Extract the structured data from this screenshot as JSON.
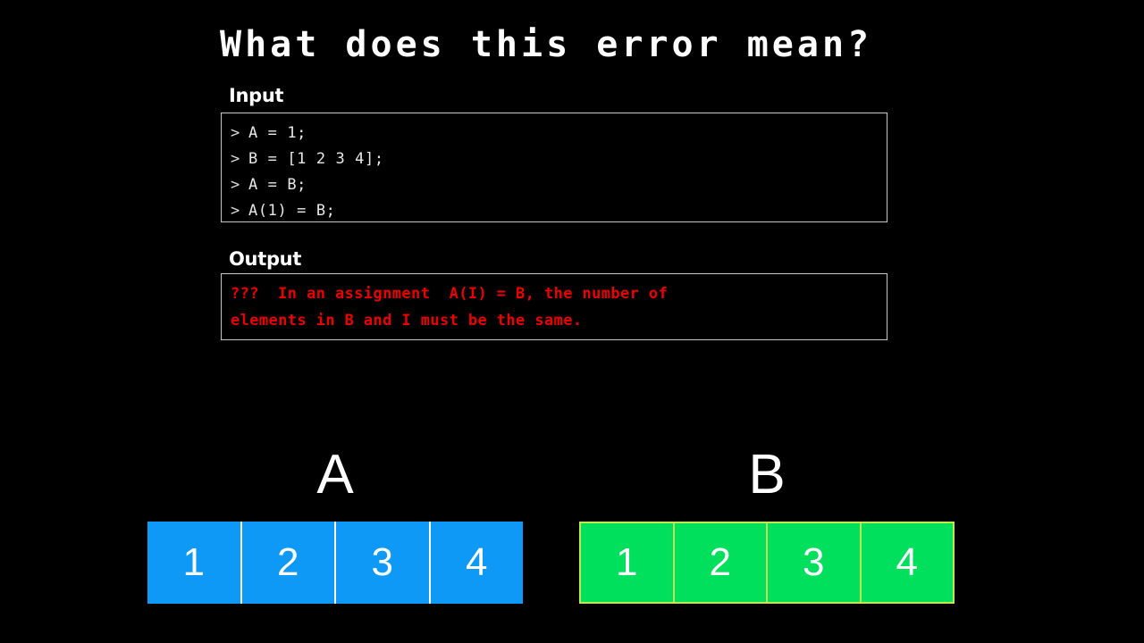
{
  "slide": {
    "background_color": "#000000",
    "title": "What does this error mean?"
  },
  "input_section": {
    "label": "Input",
    "prompt_symbol": ">",
    "lines": [
      "A = 1;",
      "B = [1 2 3 4];",
      "A = B;",
      "A(1) = B;"
    ]
  },
  "output_section": {
    "label": "Output",
    "text_color": "#ee0000",
    "lines": [
      "???  In an assignment  A(I) = B, the number of",
      "elements in B and I must be the same."
    ]
  },
  "arrays": [
    {
      "name": "A",
      "fill_color": "#0d99f5",
      "border_color": "#ffffff",
      "values": [
        "1",
        "2",
        "3",
        "4"
      ]
    },
    {
      "name": "B",
      "fill_color": "#00e05c",
      "border_color": "#c2e84f",
      "values": [
        "1",
        "2",
        "3",
        "4"
      ]
    }
  ]
}
